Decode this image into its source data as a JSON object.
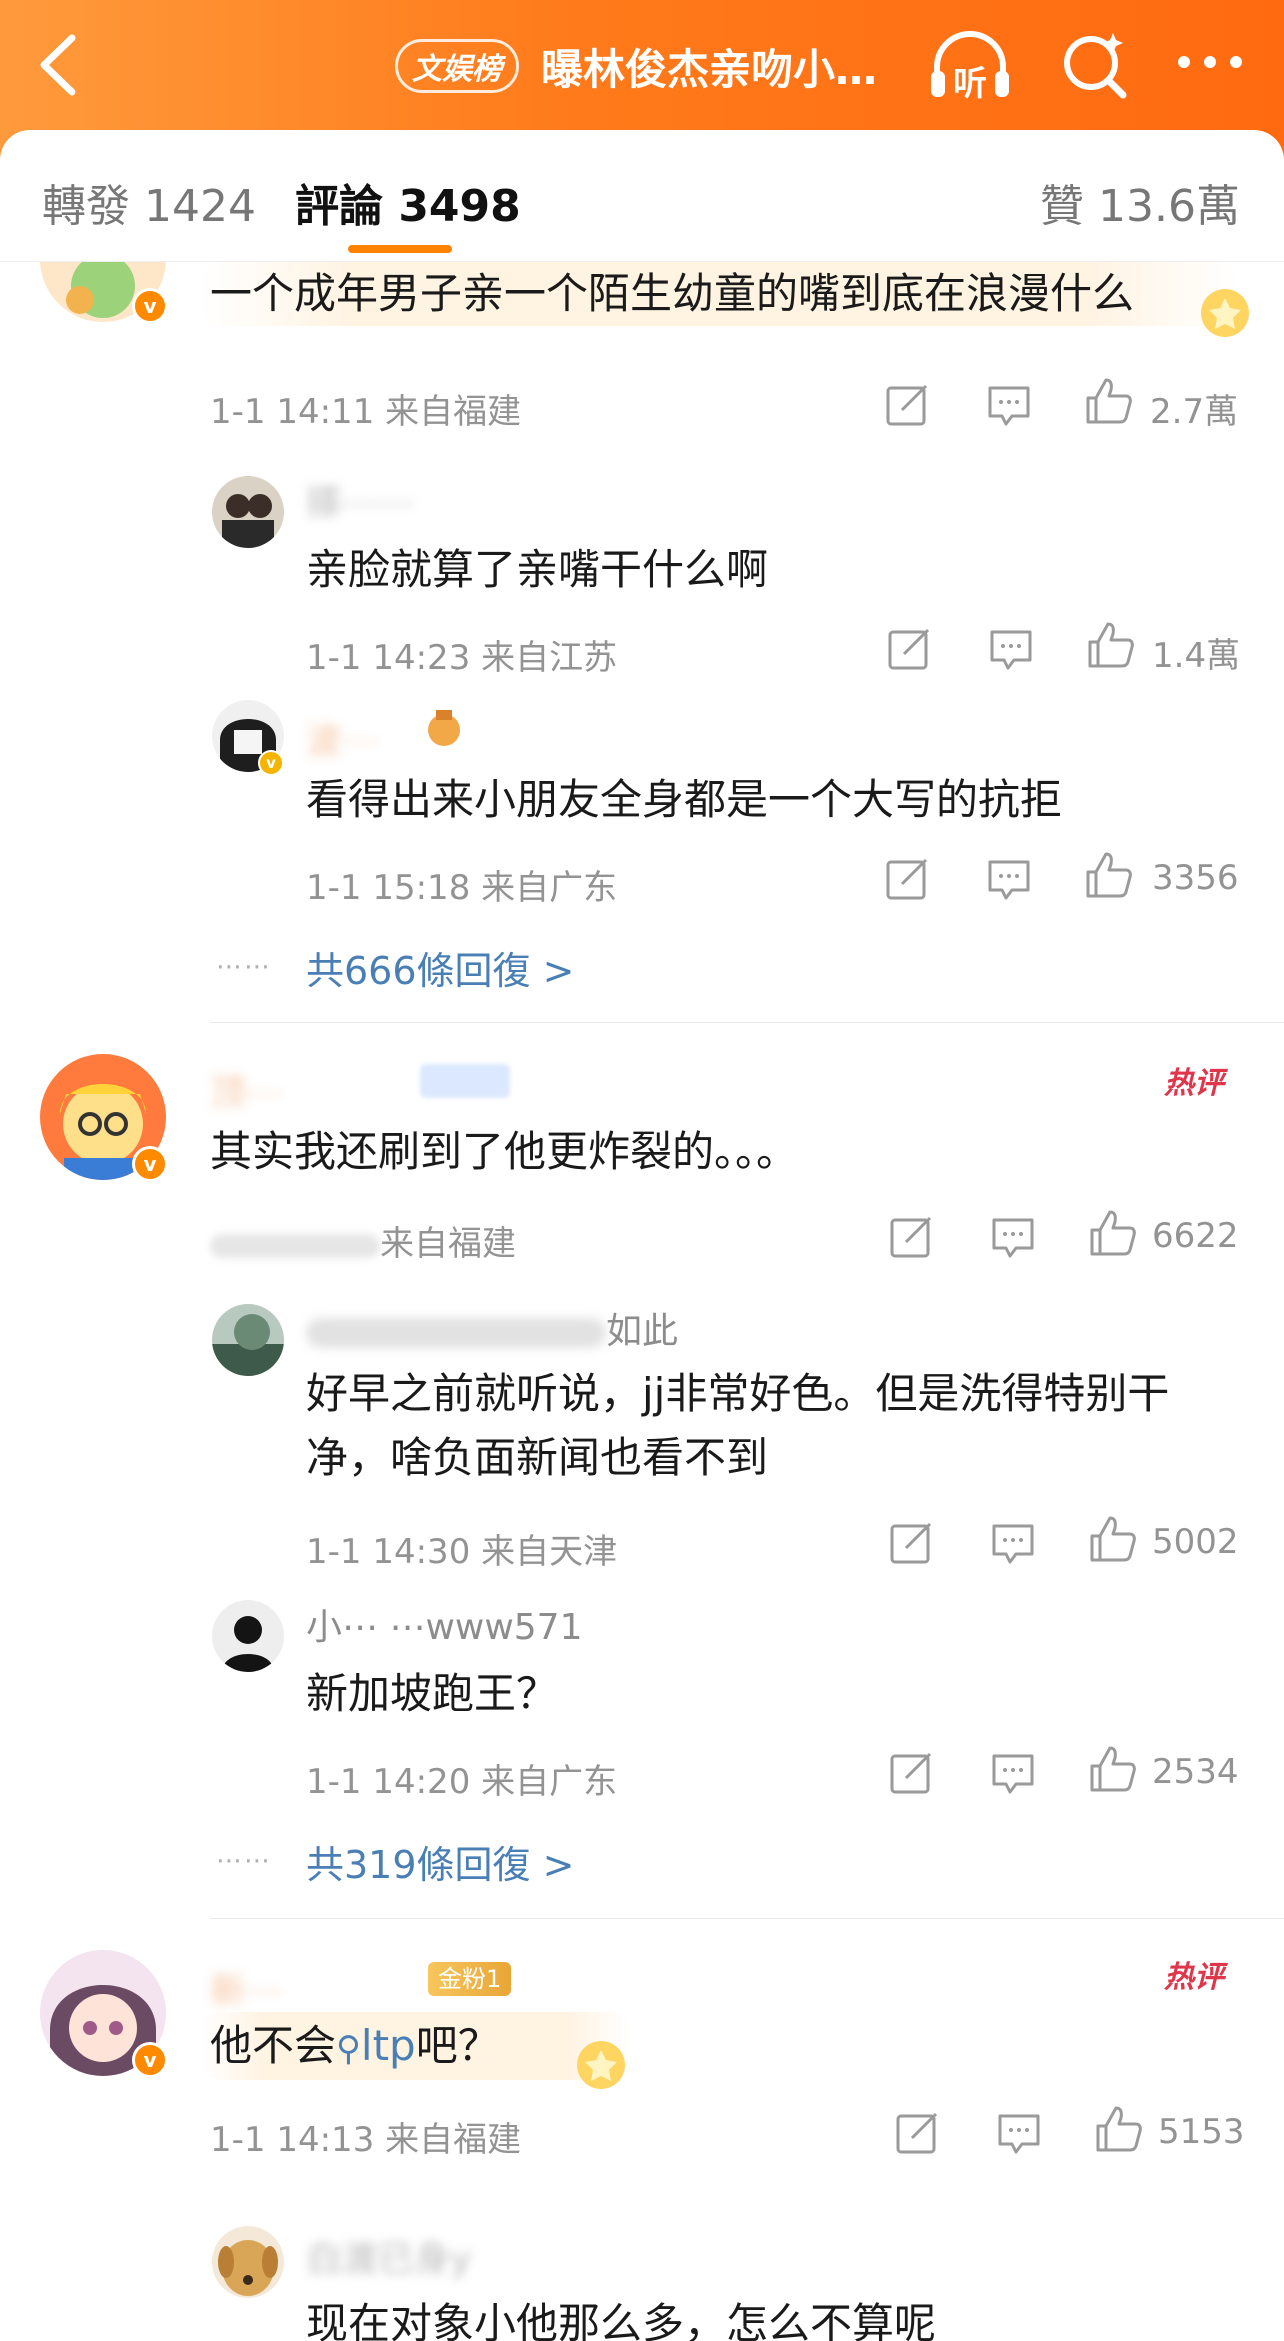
{
  "header": {
    "rank_badge": "文娱榜",
    "title": "曝林俊杰亲吻小…",
    "listen_label": "听",
    "colors": {
      "header_start": "#ff9a3c",
      "header_end": "#ff6a10",
      "accent": "#ff8200"
    }
  },
  "tabs": {
    "reposts": "轉發 1424",
    "comments": "評論 3498",
    "likes": "贊 13.6萬"
  },
  "comments": [
    {
      "text": "一个成年男子亲一个陌生幼童的嘴到底在浪漫什么",
      "meta": "1-1 14:11  来自福建",
      "likes": "2.7萬",
      "replies": [
        {
          "username": "搽⋯⋯",
          "text": "亲脸就算了亲嘴干什么啊",
          "meta": "1-1 14:23  来自江苏",
          "likes": "1.4萬"
        },
        {
          "username": "波⋯",
          "text": "看得出来小朋友全身都是一个大写的抗拒",
          "meta": "1-1 15:18  来自广东",
          "likes": "3356"
        }
      ],
      "more_replies": "共666條回復 >"
    },
    {
      "username": "顶⋯",
      "hot_badge": "热评",
      "text": "其实我还刷到了他更炸裂的。。。",
      "meta": "来自福建",
      "likes": "6622",
      "replies": [
        {
          "username": "如此",
          "text_line1": "好早之前就听说，jj非常好色。但是洗得特别干",
          "text_line2": "净，啥负面新闻也看不到",
          "meta": "1-1 14:30  来自天津",
          "likes": "5002"
        },
        {
          "username": "小⋯ ⋯www571",
          "text": "新加坡跑王？",
          "meta": "1-1 14:20  来自广东",
          "likes": "2534"
        }
      ],
      "more_replies": "共319條回復 >"
    },
    {
      "username": "新⋯",
      "fan_badge": "金粉1",
      "hot_badge": "热评",
      "text_before": "他不会",
      "search_term": "ltp",
      "text_after": "吧？",
      "meta": "1-1 14:13  来自福建",
      "likes": "5153",
      "replies": [
        {
          "username": "白渡已身y",
          "text": "现在对象小他那么多，怎么不算呢"
        }
      ]
    }
  ],
  "icons": [
    "back-arrow-icon",
    "listen-icon",
    "search-icon",
    "more-icon",
    "repost-icon",
    "comment-icon",
    "like-icon",
    "verified-badge-icon",
    "medal-icon"
  ]
}
